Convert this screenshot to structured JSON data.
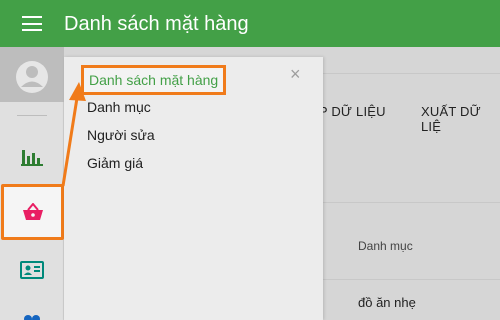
{
  "header": {
    "title": "Danh sách mặt hàng"
  },
  "tabs": {
    "import": "ẬP DỮ LIỆU",
    "export": "XUẤT DỮ LIỆ"
  },
  "table": {
    "column_header": "Danh mục",
    "first_cell": "đồ ăn nhẹ"
  },
  "menu": {
    "items": [
      {
        "label": "Danh sách mặt hàng",
        "active": true
      },
      {
        "label": "Danh mục"
      },
      {
        "label": "Người sửa"
      },
      {
        "label": "Giảm giá"
      }
    ],
    "close_label": "×"
  },
  "icons": [
    "menu-icon",
    "avatar-icon",
    "bar-chart-icon",
    "basket-icon",
    "id-card-icon",
    "people-icon",
    "close-icon"
  ],
  "colors": {
    "header_bg": "#43a047",
    "highlight": "#f07b1a",
    "basket": "#e91e63",
    "chart": "#2e7d32",
    "card": "#00897b",
    "people": "#1565c0"
  }
}
